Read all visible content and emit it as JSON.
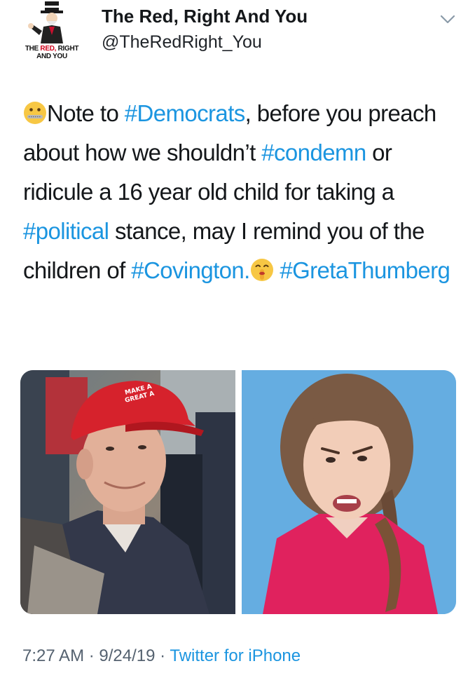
{
  "tweet": {
    "author": {
      "display_name": "The Red, Right And You",
      "handle": "@TheRedRight_You",
      "avatar_logo_text": {
        "line1_a": "THE ",
        "line1_red": "RED, ",
        "line1_b": "RIGHT",
        "line2": "AND YOU"
      }
    },
    "text": {
      "seg1": "Note to ",
      "tag_democrats": "#Democrats",
      "seg2": ", before you preach about how we shouldn’t ",
      "tag_condemn": "#condemn",
      "seg3": " or ridicule a 16 year old child for taking a ",
      "tag_political": "#political",
      "seg4": " stance, may I remind you of the children of ",
      "tag_covington": "#Covington.",
      "seg5": " ",
      "tag_greta": "#GretaThumberg"
    },
    "emojis": [
      "zipper-mouth-face",
      "shushing-face"
    ],
    "media": {
      "left_photo": {
        "cap_text_1": "MAKE A",
        "cap_text_2": "GREAT A"
      },
      "right_photo": {}
    },
    "meta": {
      "time": "7:27 AM",
      "sep1": " · ",
      "date": "9/24/19",
      "sep2": " · ",
      "source": "Twitter for iPhone"
    },
    "colors": {
      "hashtag": "#1b95e0",
      "text": "#14171a",
      "meta": "#556270"
    }
  }
}
